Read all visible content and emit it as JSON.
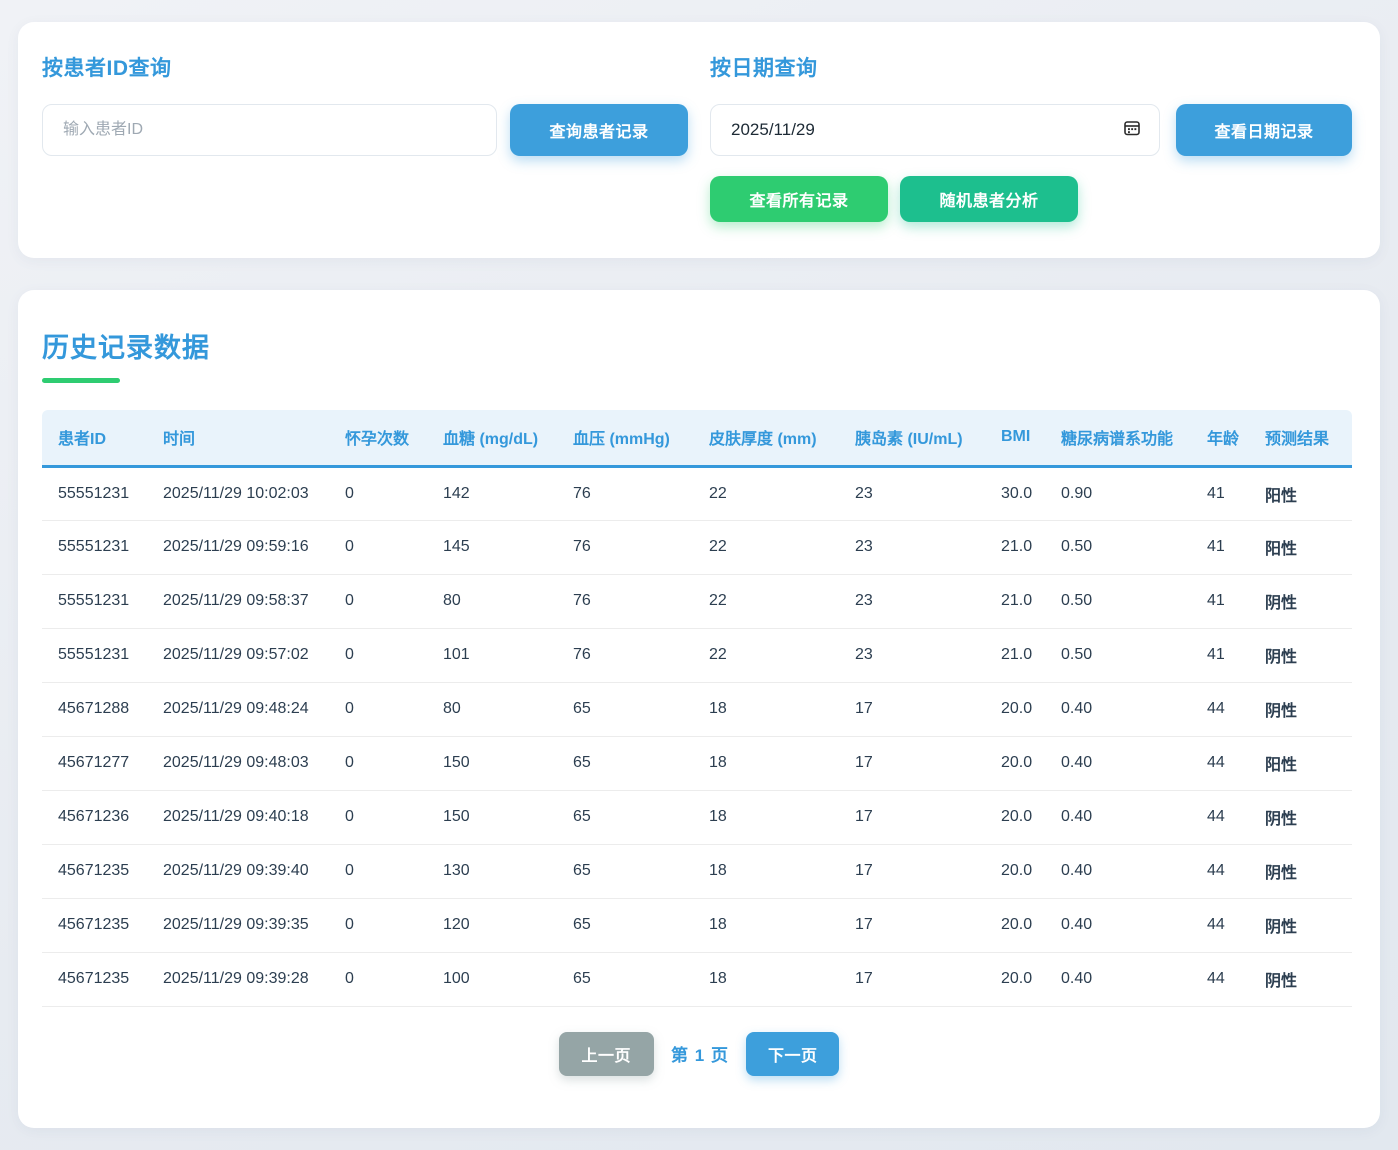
{
  "colors": {
    "accent_blue": "#3d9fdc",
    "heading_blue": "#3498db",
    "green": "#2ecc71",
    "teal": "#1dbf8e",
    "gray": "#95a5a6",
    "positive_red": "#e74c3c",
    "negative_green": "#2ecc71",
    "header_bg": "#e9f3fb"
  },
  "search_panel": {
    "by_id": {
      "title": "按患者ID查询",
      "input_placeholder": "输入患者ID",
      "input_value": "",
      "button": "查询患者记录"
    },
    "by_date": {
      "title": "按日期查询",
      "date_value": "2025/11/29",
      "calendar_icon": "calendar-icon",
      "button": "查看日期记录",
      "all_records_button": "查看所有记录",
      "random_analysis_button": "随机患者分析"
    }
  },
  "history": {
    "title": "历史记录数据",
    "columns": [
      "患者ID",
      "时间",
      "怀孕次数",
      "血糖 (mg/dL)",
      "血压 (mmHg)",
      "皮肤厚度 (mm)",
      "胰岛素 (IU/mL)",
      "BMI",
      "糖尿病谱系功能",
      "年龄",
      "预测结果"
    ],
    "rows": [
      {
        "patient_id": "55551231",
        "time": "2025/11/29 10:02:03",
        "pregnancies": "0",
        "glucose": "142",
        "bp": "76",
        "skin": "22",
        "insulin": "23",
        "bmi": "30.0",
        "dpf": "0.90",
        "age": "41",
        "result": "阳性",
        "result_type": "positive"
      },
      {
        "patient_id": "55551231",
        "time": "2025/11/29 09:59:16",
        "pregnancies": "0",
        "glucose": "145",
        "bp": "76",
        "skin": "22",
        "insulin": "23",
        "bmi": "21.0",
        "dpf": "0.50",
        "age": "41",
        "result": "阳性",
        "result_type": "positive"
      },
      {
        "patient_id": "55551231",
        "time": "2025/11/29 09:58:37",
        "pregnancies": "0",
        "glucose": "80",
        "bp": "76",
        "skin": "22",
        "insulin": "23",
        "bmi": "21.0",
        "dpf": "0.50",
        "age": "41",
        "result": "阴性",
        "result_type": "negative"
      },
      {
        "patient_id": "55551231",
        "time": "2025/11/29 09:57:02",
        "pregnancies": "0",
        "glucose": "101",
        "bp": "76",
        "skin": "22",
        "insulin": "23",
        "bmi": "21.0",
        "dpf": "0.50",
        "age": "41",
        "result": "阴性",
        "result_type": "negative"
      },
      {
        "patient_id": "45671288",
        "time": "2025/11/29 09:48:24",
        "pregnancies": "0",
        "glucose": "80",
        "bp": "65",
        "skin": "18",
        "insulin": "17",
        "bmi": "20.0",
        "dpf": "0.40",
        "age": "44",
        "result": "阴性",
        "result_type": "negative"
      },
      {
        "patient_id": "45671277",
        "time": "2025/11/29 09:48:03",
        "pregnancies": "0",
        "glucose": "150",
        "bp": "65",
        "skin": "18",
        "insulin": "17",
        "bmi": "20.0",
        "dpf": "0.40",
        "age": "44",
        "result": "阳性",
        "result_type": "positive"
      },
      {
        "patient_id": "45671236",
        "time": "2025/11/29 09:40:18",
        "pregnancies": "0",
        "glucose": "150",
        "bp": "65",
        "skin": "18",
        "insulin": "17",
        "bmi": "20.0",
        "dpf": "0.40",
        "age": "44",
        "result": "阴性",
        "result_type": "negative"
      },
      {
        "patient_id": "45671235",
        "time": "2025/11/29 09:39:40",
        "pregnancies": "0",
        "glucose": "130",
        "bp": "65",
        "skin": "18",
        "insulin": "17",
        "bmi": "20.0",
        "dpf": "0.40",
        "age": "44",
        "result": "阴性",
        "result_type": "negative"
      },
      {
        "patient_id": "45671235",
        "time": "2025/11/29 09:39:35",
        "pregnancies": "0",
        "glucose": "120",
        "bp": "65",
        "skin": "18",
        "insulin": "17",
        "bmi": "20.0",
        "dpf": "0.40",
        "age": "44",
        "result": "阴性",
        "result_type": "negative"
      },
      {
        "patient_id": "45671235",
        "time": "2025/11/29 09:39:28",
        "pregnancies": "0",
        "glucose": "100",
        "bp": "65",
        "skin": "18",
        "insulin": "17",
        "bmi": "20.0",
        "dpf": "0.40",
        "age": "44",
        "result": "阴性",
        "result_type": "negative"
      }
    ],
    "pagination": {
      "prev": "上一页",
      "page_label": "第 1 页",
      "next": "下一页"
    }
  }
}
